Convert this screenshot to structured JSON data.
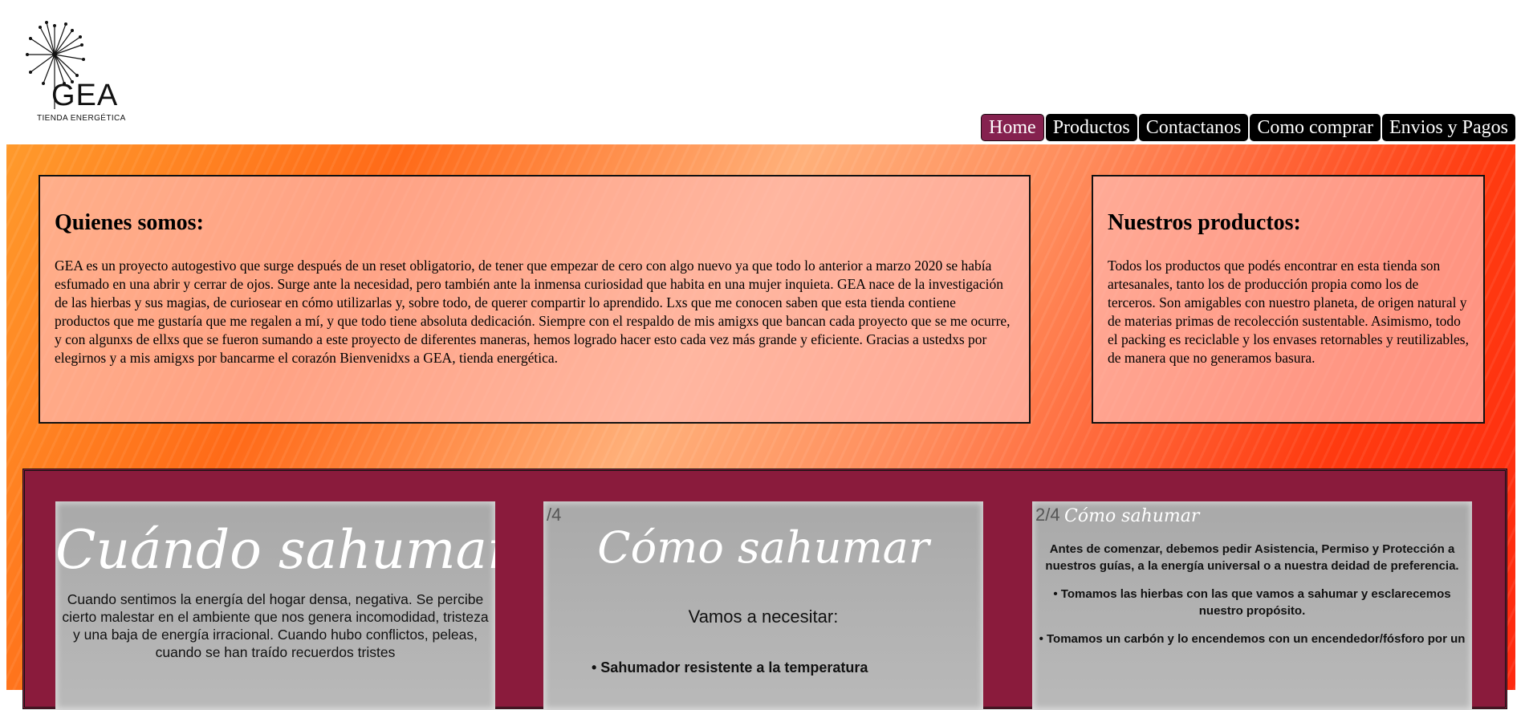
{
  "brand": {
    "name": "GEA",
    "tagline": "TIENDA ENERGÉTICA"
  },
  "nav": {
    "items": [
      {
        "label": "Home",
        "active": true
      },
      {
        "label": "Productos",
        "active": false
      },
      {
        "label": "Contactanos",
        "active": false
      },
      {
        "label": "Como comprar",
        "active": false
      },
      {
        "label": "Envios y Pagos",
        "active": false
      }
    ]
  },
  "about": {
    "title": "Quienes somos:",
    "body": "GEA es un proyecto autogestivo que surge después de un reset obligatorio, de tener que empezar de cero con algo nuevo ya que todo lo anterior a marzo 2020 se había esfumado en una abrir y cerrar de ojos. Surge ante la necesidad, pero también ante la inmensa curiosidad que habita en una mujer inquieta. GEA nace de la investigación de las hierbas y sus magias, de curiosear en cómo utilizarlas y, sobre todo, de querer compartir lo aprendido. Lxs que me conocen saben que esta tienda contiene productos que me gustaría que me regalen a mí, y que todo tiene absoluta dedicación. Siempre con el respaldo de mis amigxs que bancan cada proyecto que se me ocurre, y con algunxs de ellxs que se fueron sumando a este proyecto de diferentes maneras, hemos logrado hacer esto cada vez más grande y eficiente. Gracias a ustedxs por elegirnos y a mis amigxs por bancarme el corazón Bienvenidxs a GEA, tienda energética."
  },
  "products": {
    "title": "Nuestros productos:",
    "body": "Todos los productos que podés encontrar en esta tienda son artesanales, tanto los de producción propia como los de terceros. Son amigables con nuestro planeta, de origen natural y de materias primas de recolección sustentable. Asimismo, todo el packing es reciclable y los envases retornables y reutilizables, de manera que no generamos basura."
  },
  "gallery": {
    "card1": {
      "title": "Cuándo sahumar?",
      "text": "Cuando  sentimos la energía del hogar densa, negativa. Se percibe cierto malestar en el ambiente que nos genera incomodidad, tristeza y una baja de energía irracional. Cuando hubo conflictos, peleas, cuando se han traído recuerdos tristes"
    },
    "card2": {
      "page": "/4",
      "title": "Cómo sahumar",
      "subtitle": "Vamos a necesitar:",
      "bullet": "• Sahumador resistente a la temperatura"
    },
    "card3": {
      "page": "2/4",
      "title": "Cómo sahumar",
      "line1": "Antes de comenzar, debemos pedir Asistencia, Permiso y Protección a nuestros guías, a la energía universal  o a nuestra deidad de preferencia.",
      "line2": "• Tomamos las hierbas con las que vamos a sahumar y esclarecemos nuestro propósito.",
      "line3": "• Tomamos un carbón y lo encendemos con un encendedor/fósforo por un"
    }
  },
  "colors": {
    "nav_bg": "#000000",
    "nav_active": "#85214f",
    "gallery_bg": "#8a1b3c",
    "hero_warm": "#ff6a18"
  }
}
